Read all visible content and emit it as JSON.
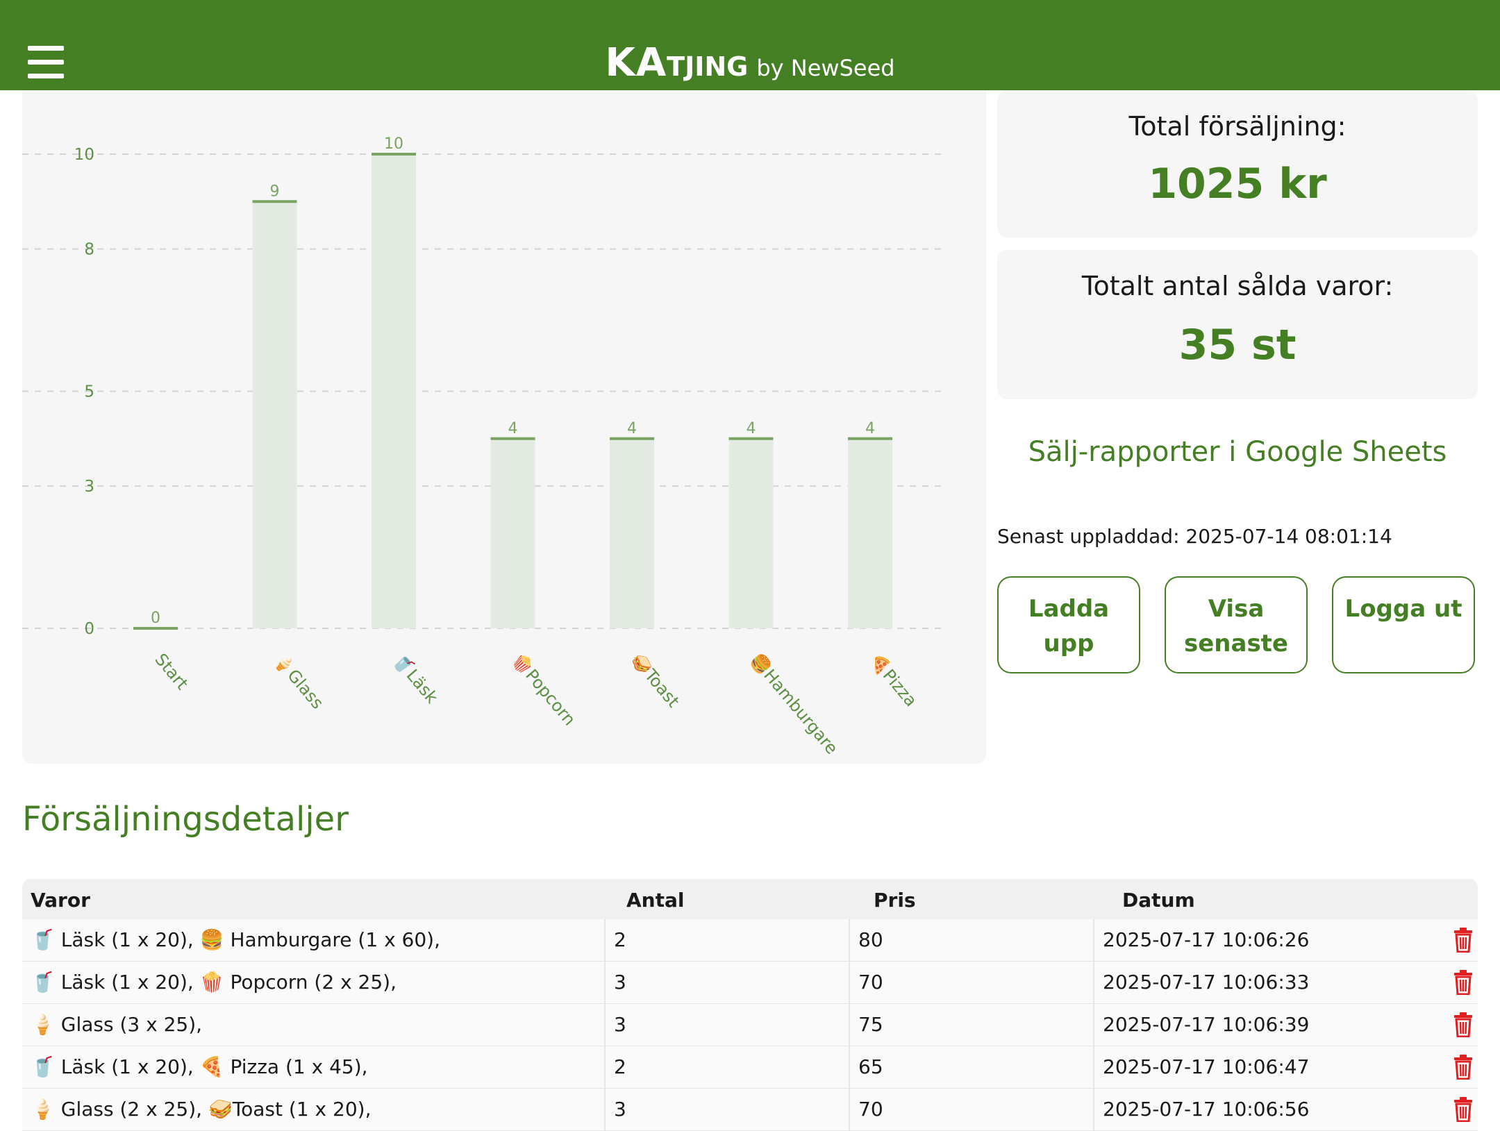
{
  "header": {
    "brand_ka": "KA",
    "brand_tjing": "TJING",
    "brand_by": "by NewSeed"
  },
  "colors": {
    "brand_green": "#457f24",
    "bar_fill": "#e4ebe2",
    "bar_top": "#7aa463",
    "delete_red": "#e02020"
  },
  "chart_data": {
    "type": "bar",
    "categories": [
      "Start",
      "🍦Glass",
      "🥤Läsk",
      "🍿Popcorn",
      "🥪Toast",
      "🍔Hamburgare",
      "🍕Pizza"
    ],
    "values": [
      0,
      9,
      10,
      4,
      4,
      4,
      4
    ],
    "value_labels": [
      "0",
      "9",
      "10",
      "4",
      "4",
      "4",
      "4"
    ],
    "ylim": [
      0,
      10
    ],
    "yticks": [
      0,
      3,
      5,
      8,
      10
    ],
    "ytick_labels": [
      "0",
      "3",
      "5",
      "8",
      "10"
    ],
    "grid": true,
    "xlabel": "",
    "ylabel": "",
    "title": ""
  },
  "stats": {
    "total_sales_label": "Total försäljning:",
    "total_sales_value": "1025 kr",
    "total_items_label": "Totalt antal sålda varor:",
    "total_items_value": "35 st"
  },
  "links": {
    "sheets": "Sälj-rapporter i Google Sheets"
  },
  "upload": {
    "last_uploaded": "Senast uppladdad: 2025-07-14 08:01:14"
  },
  "buttons": {
    "upload_line1": "Ladda",
    "upload_line2": "upp",
    "latest_line1": "Visa",
    "latest_line2": "senaste",
    "logout": "Logga ut"
  },
  "sales": {
    "title": "Försäljningsdetaljer",
    "columns": [
      "Varor",
      "Antal",
      "Pris",
      "Datum"
    ],
    "rows": [
      {
        "items": "🥤 Läsk (1 x 20), 🍔 Hamburgare (1 x 60),",
        "qty": "2",
        "price": "80",
        "date": "2025-07-17 10:06:26"
      },
      {
        "items": "🥤 Läsk (1 x 20), 🍿 Popcorn (2 x 25),",
        "qty": "3",
        "price": "70",
        "date": "2025-07-17 10:06:33"
      },
      {
        "items": "🍦 Glass (3 x 25),",
        "qty": "3",
        "price": "75",
        "date": "2025-07-17 10:06:39"
      },
      {
        "items": "🥤 Läsk (1 x 20), 🍕 Pizza (1 x 45),",
        "qty": "2",
        "price": "65",
        "date": "2025-07-17 10:06:47"
      },
      {
        "items": "🍦 Glass (2 x 25), 🥪Toast (1 x 20),",
        "qty": "3",
        "price": "70",
        "date": "2025-07-17 10:06:56"
      }
    ]
  }
}
